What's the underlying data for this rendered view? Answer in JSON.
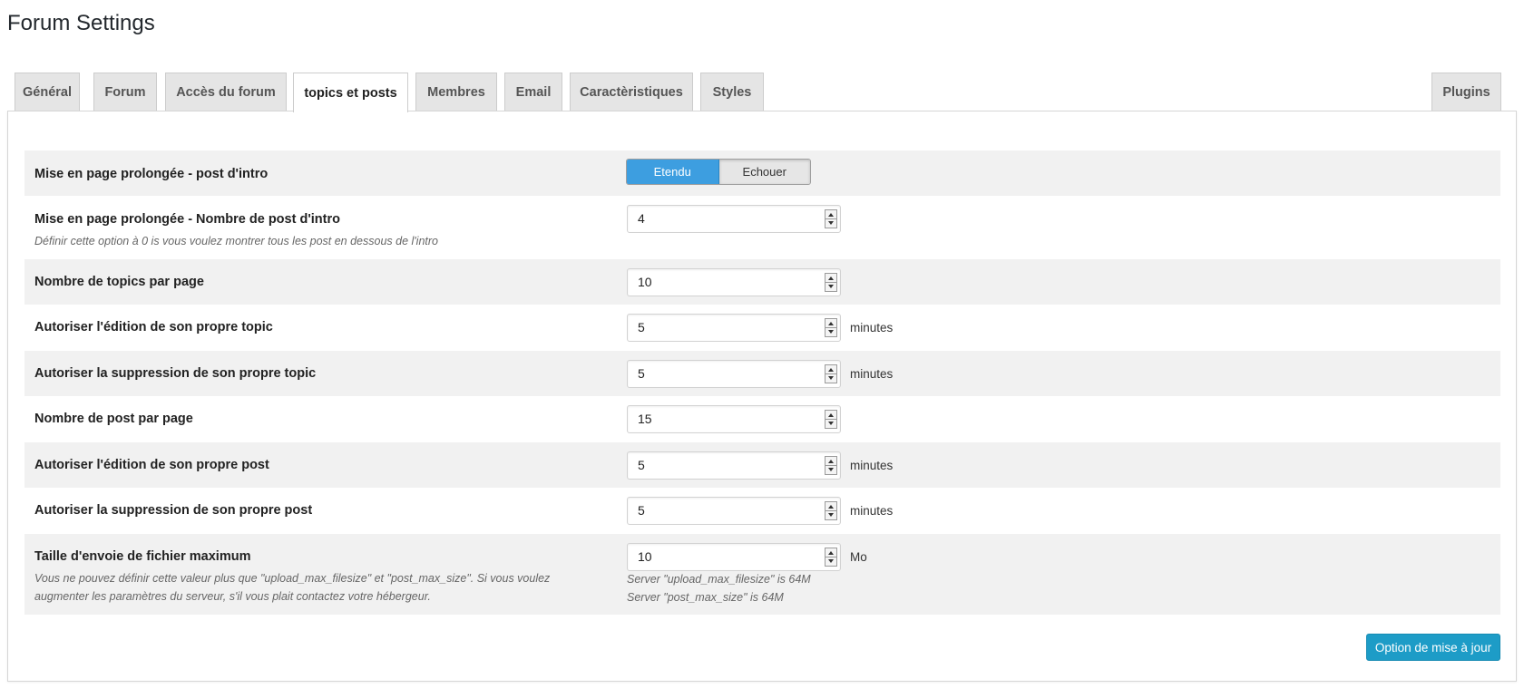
{
  "page": {
    "title": "Forum Settings"
  },
  "tabs": [
    {
      "label": "Général"
    },
    {
      "label": "Forum"
    },
    {
      "label": "Accès du forum"
    },
    {
      "label": "topics et posts",
      "active": true
    },
    {
      "label": "Membres"
    },
    {
      "label": "Email"
    },
    {
      "label": "Caractèristiques"
    },
    {
      "label": "Styles"
    },
    {
      "label": "Plugins"
    }
  ],
  "settings": [
    {
      "label": "Mise en page prolongée - post d'intro",
      "type": "toggle",
      "on_label": "Etendu",
      "off_label": "Echouer",
      "selected": "Etendu"
    },
    {
      "label": "Mise en page prolongée - Nombre de post d'intro",
      "description": "Définir cette option à 0 is vous voulez montrer tous les post en dessous de l'intro",
      "value": "4"
    },
    {
      "label": "Nombre de topics par page",
      "value": "10"
    },
    {
      "label": "Autoriser l'édition de son propre topic",
      "value": "5",
      "unit": "minutes"
    },
    {
      "label": "Autoriser la suppression de son propre topic",
      "value": "5",
      "unit": "minutes"
    },
    {
      "label": "Nombre de post par page",
      "value": "15"
    },
    {
      "label": "Autoriser l'édition de son propre post",
      "value": "5",
      "unit": "minutes"
    },
    {
      "label": "Autoriser la suppression de son propre post",
      "value": "5",
      "unit": "minutes"
    },
    {
      "label": "Taille d'envoie de fichier maximum",
      "description_line1": "Vous ne pouvez définir cette valeur plus que \"upload_max_filesize\" et \"post_max_size\". Si vous voulez",
      "description_line2": "augmenter les paramètres du serveur, s'il vous plait contactez votre hébergeur.",
      "value": "10",
      "unit": "Mo",
      "server_note1": "Server \"upload_max_filesize\" is 64M",
      "server_note2": "Server \"post_max_size\" is 64M"
    }
  ],
  "actions": {
    "submit_label": "Option de mise à jour"
  },
  "colors": {
    "toggle_active": "#3d9ee0",
    "submit_button": "#1d9cc7"
  }
}
